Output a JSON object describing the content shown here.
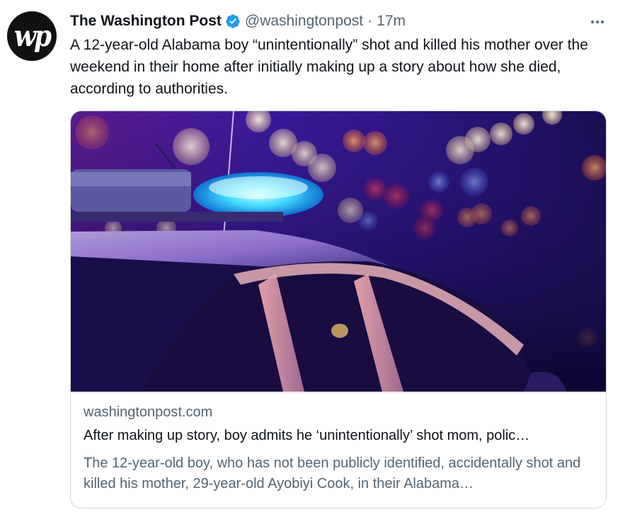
{
  "author": {
    "avatar_text": "wp",
    "display_name": "The Washington Post",
    "verified": true,
    "handle": "@washingtonpost",
    "separator": "·",
    "time": "17m"
  },
  "tweet": {
    "text": "A 12-year-old Alabama boy “unintentionally” shot and killed his mother over the weekend in their home after initially making up a story about how she died, according to authorities."
  },
  "card": {
    "image_icon": "police-car-lights-photo",
    "domain": "washingtonpost.com",
    "title": "After making up story, boy admits he ‘unintentionally’ shot mom, polic…",
    "description": "The 12-year-old boy, who has not been publicly identified, accidentally shot and killed his mother, 29-year-old Ayobiyi Cook, in their Alabama…"
  },
  "colors": {
    "text_primary": "#0f1419",
    "text_secondary": "#536471",
    "verified_blue": "#1d9bf0",
    "border": "#cfd9de"
  }
}
